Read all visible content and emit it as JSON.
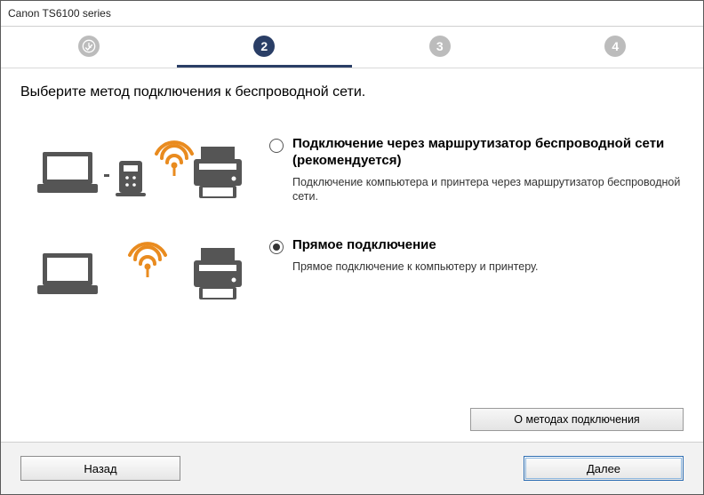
{
  "window": {
    "title": "Canon TS6100 series"
  },
  "steps": {
    "labels": [
      "",
      "2",
      "3",
      "4"
    ],
    "activeIndex": 1
  },
  "heading": "Выберите метод подключения к беспроводной сети.",
  "options": [
    {
      "title": "Подключение через маршрутизатор беспроводной сети (рекомендуется)",
      "desc": "Подключение компьютера и принтера через маршрутизатор беспроводной сети.",
      "checked": false
    },
    {
      "title": "Прямое подключение",
      "desc": "Прямое подключение к компьютеру и принтеру.",
      "checked": true
    }
  ],
  "buttons": {
    "methods": "О методах подключения",
    "back": "Назад",
    "next": "Далее"
  }
}
